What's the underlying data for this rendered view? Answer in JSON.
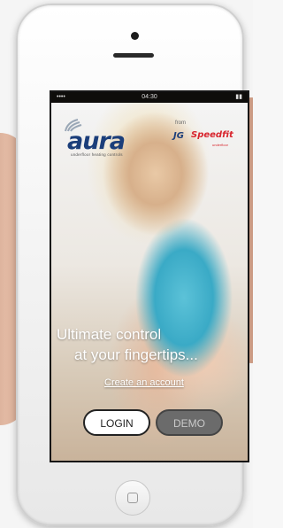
{
  "status_bar": {
    "signal": "••••",
    "time": "04:30",
    "battery": "▮▮"
  },
  "branding": {
    "logo": "aura",
    "tagline": "underfloor heating controls",
    "from_label": "from",
    "partner_logo_a": "JG",
    "partner_logo_b": "Speedfit",
    "partner_sub": "underfloor"
  },
  "hero": {
    "headline_line1": "Ultimate control",
    "headline_line2": "at your fingertips..."
  },
  "actions": {
    "create_account": "Create an account",
    "login_label": "LOGIN",
    "demo_label": "DEMO"
  },
  "colors": {
    "brand_blue": "#1b3e7a",
    "partner_red": "#d8262e",
    "demo_button": "#6b6b6b"
  }
}
